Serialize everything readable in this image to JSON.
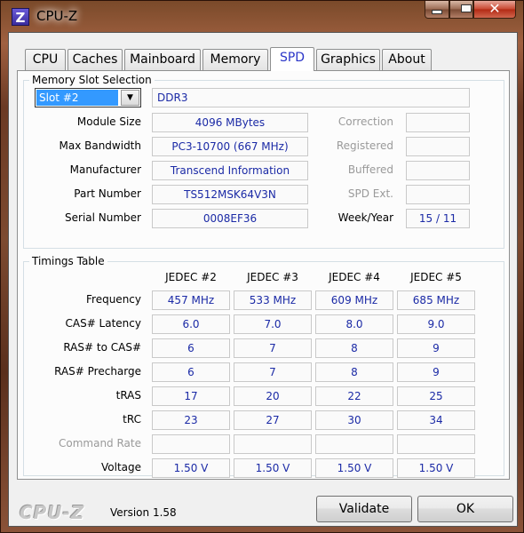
{
  "window": {
    "title": "CPU-Z",
    "app_icon_letter": "Z",
    "close_glyph": "✕"
  },
  "tabs": [
    {
      "label": "CPU",
      "active": false
    },
    {
      "label": "Caches",
      "active": false
    },
    {
      "label": "Mainboard",
      "active": false
    },
    {
      "label": "Memory",
      "active": false
    },
    {
      "label": "SPD",
      "active": true
    },
    {
      "label": "Graphics",
      "active": false
    },
    {
      "label": "About",
      "active": false
    }
  ],
  "slot_section": {
    "title": "Memory Slot Selection",
    "slot_value": "Slot #2",
    "memory_type": "DDR3",
    "fields": {
      "module_size": {
        "label": "Module Size",
        "value": "4096 MBytes"
      },
      "max_bandwidth": {
        "label": "Max Bandwidth",
        "value": "PC3-10700 (667 MHz)"
      },
      "manufacturer": {
        "label": "Manufacturer",
        "value": "Transcend Information"
      },
      "part_number": {
        "label": "Part Number",
        "value": "TS512MSK64V3N"
      },
      "serial_number": {
        "label": "Serial Number",
        "value": "0008EF36"
      }
    },
    "right_fields": {
      "correction": {
        "label": "Correction",
        "value": ""
      },
      "registered": {
        "label": "Registered",
        "value": ""
      },
      "buffered": {
        "label": "Buffered",
        "value": ""
      },
      "spd_ext": {
        "label": "SPD Ext.",
        "value": ""
      },
      "week_year": {
        "label": "Week/Year",
        "value": "15 / 11"
      }
    }
  },
  "timings": {
    "title": "Timings Table",
    "columns": [
      "JEDEC #2",
      "JEDEC #3",
      "JEDEC #4",
      "JEDEC #5"
    ],
    "rows": [
      {
        "label": "Frequency",
        "values": [
          "457 MHz",
          "533 MHz",
          "609 MHz",
          "685 MHz"
        ]
      },
      {
        "label": "CAS# Latency",
        "values": [
          "6.0",
          "7.0",
          "8.0",
          "9.0"
        ]
      },
      {
        "label": "RAS# to CAS#",
        "values": [
          "6",
          "7",
          "8",
          "9"
        ]
      },
      {
        "label": "RAS# Precharge",
        "values": [
          "6",
          "7",
          "8",
          "9"
        ]
      },
      {
        "label": "tRAS",
        "values": [
          "17",
          "20",
          "22",
          "25"
        ]
      },
      {
        "label": "tRC",
        "values": [
          "23",
          "27",
          "30",
          "34"
        ]
      },
      {
        "label": "Command Rate",
        "values": [
          "",
          "",
          "",
          ""
        ]
      },
      {
        "label": "Voltage",
        "values": [
          "1.50 V",
          "1.50 V",
          "1.50 V",
          "1.50 V"
        ]
      }
    ]
  },
  "footer": {
    "logo": "CPU-Z",
    "version": "Version 1.58",
    "validate_label": "Validate",
    "ok_label": "OK"
  },
  "colors": {
    "value_text": "#1b2aa6",
    "active_tab_text": "#2a35c8",
    "selection": "#3399ff"
  }
}
